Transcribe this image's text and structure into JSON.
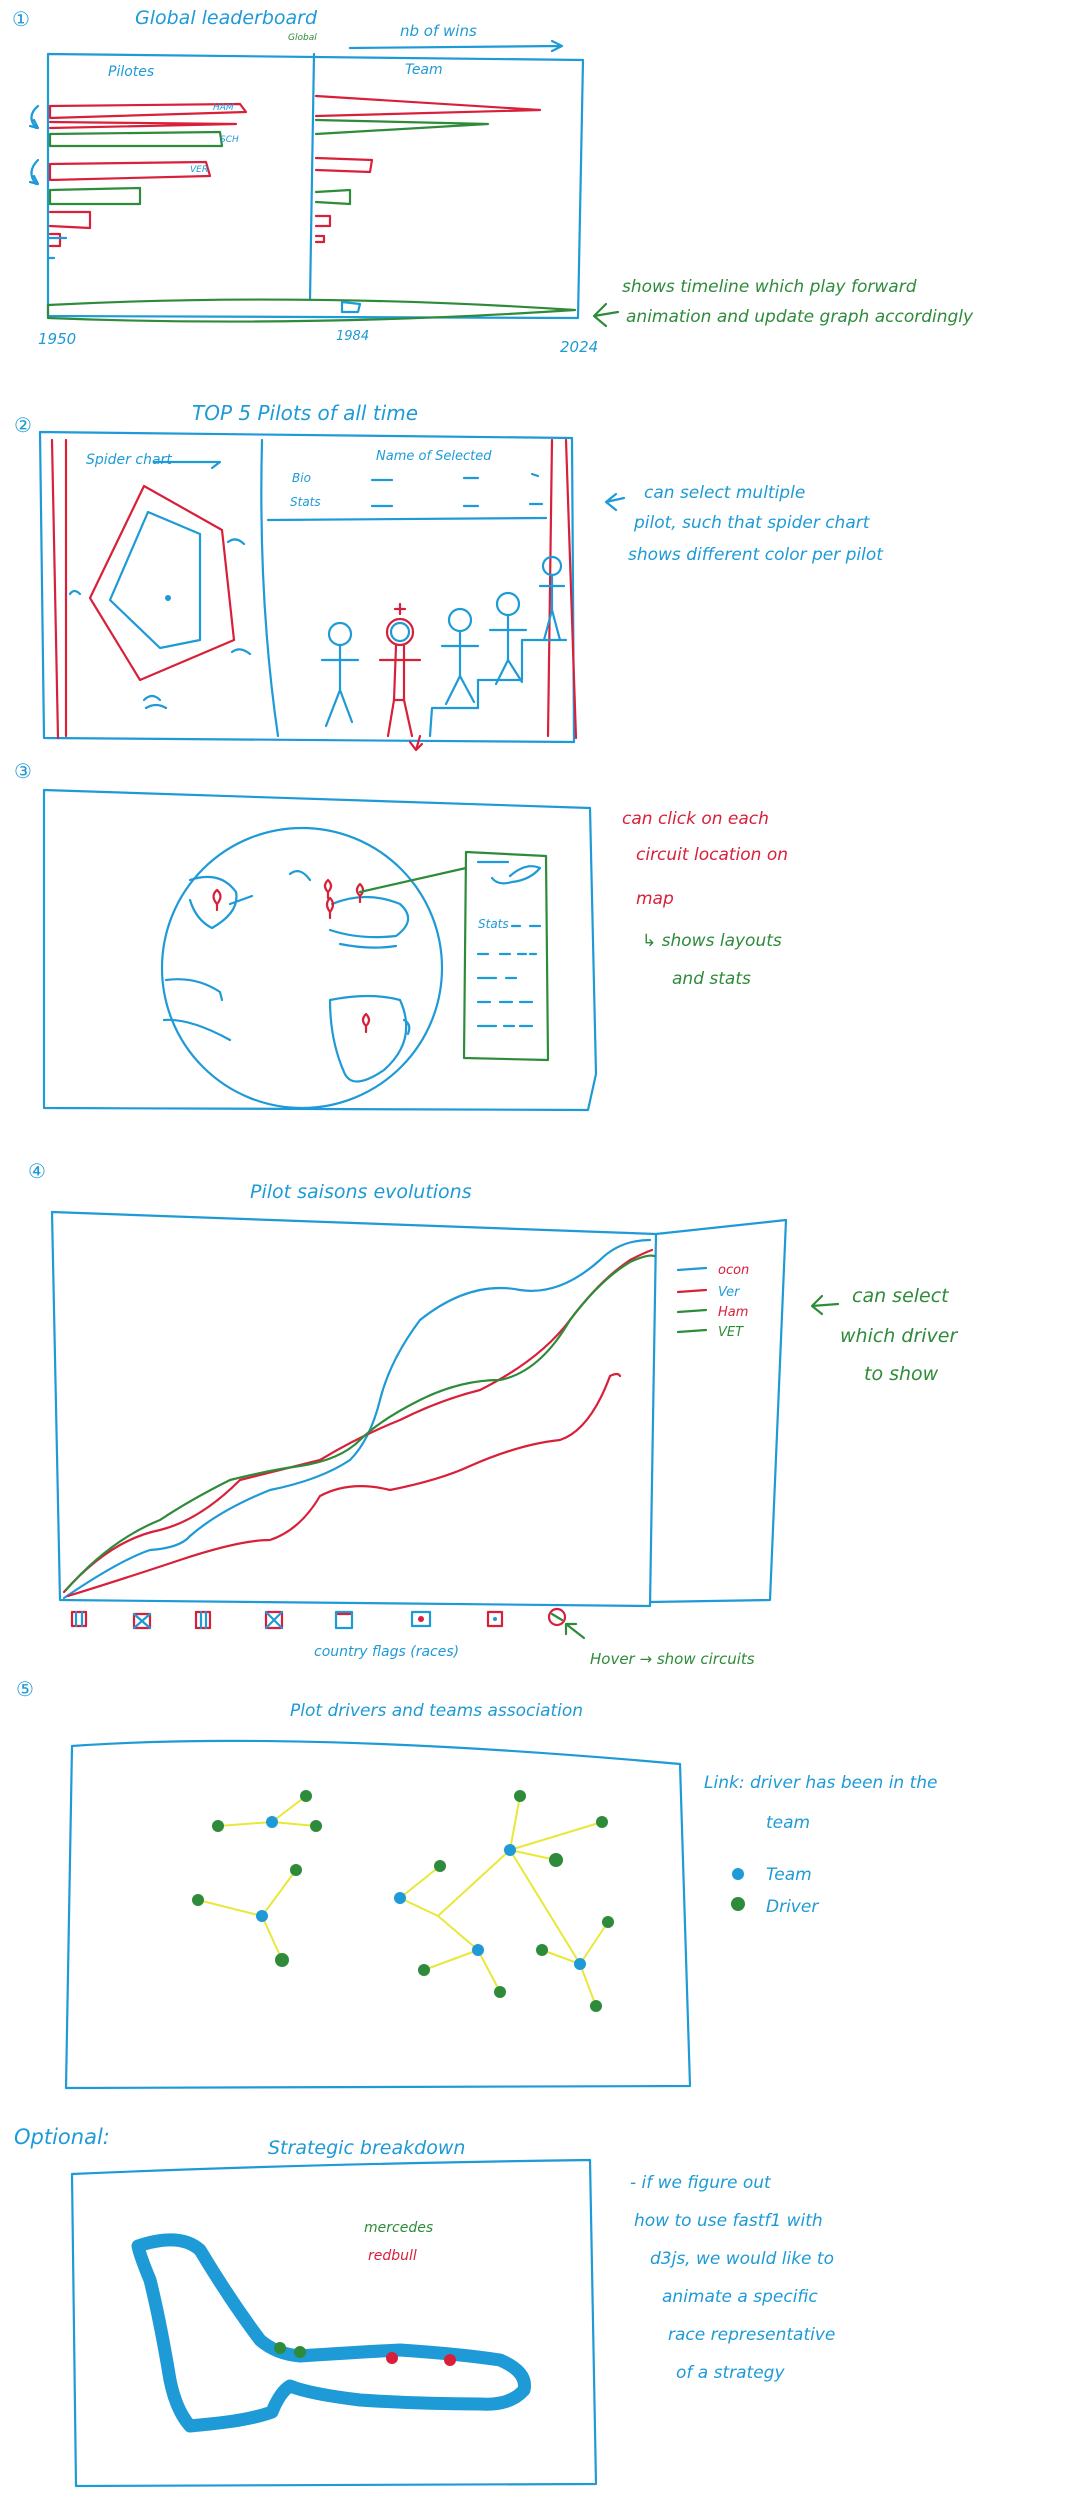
{
  "colors": {
    "blue": "#1e9ad6",
    "green": "#2e8b3a",
    "red": "#d8203a",
    "yellow": "#e8e838"
  },
  "s1": {
    "num": "①",
    "title": "Global leaderboard",
    "title_sub": "Global",
    "wins_label": "nb of wins",
    "col_pilotes": "Pilotes",
    "col_team": "Team",
    "pilot_labels": [
      "HAM",
      "SCH",
      "VER"
    ],
    "year_start": "1950",
    "year_mid": "1984",
    "year_end": "2024",
    "note_line1": "shows timeline which play forward",
    "note_line2": "animation and update graph accordingly"
  },
  "s2": {
    "num": "②",
    "title": "TOP 5 Pilots of all time",
    "spider_label": "Spider chart",
    "name_label": "Name of Selected",
    "bio_label": "Bio",
    "stats_label": "Stats",
    "note_line1": "can select multiple",
    "note_line2": "pilot, such that spider chart",
    "note_line3": "shows different color per pilot"
  },
  "s3": {
    "num": "③",
    "panel_stats": "Stats",
    "note_line1": "can click on each",
    "note_line2": "circuit location on",
    "note_line3": "map",
    "note_line4": "↳ shows layouts",
    "note_line5": "and stats"
  },
  "s4": {
    "num": "④",
    "title": "Pilot saisons evolutions",
    "legend": [
      "ocon",
      "Ver",
      "Ham",
      "VET"
    ],
    "flags_label": "country flags (races)",
    "hover_label": "Hover → show circuits",
    "note_line1": "can select",
    "note_line2": "which driver",
    "note_line3": "to show"
  },
  "s5": {
    "num": "⑤",
    "title": "Plot drivers and teams association",
    "link_line1": "Link: driver has been in the",
    "link_line2": "team",
    "legend_team": "Team",
    "legend_driver": "Driver"
  },
  "s6": {
    "optional": "Optional:",
    "title": "Strategic breakdown",
    "team1": "mercedes",
    "team2": "redbull",
    "note_line1": "- if we figure out",
    "note_line2": "how to use fastf1 with",
    "note_line3": "d3js, we would like to",
    "note_line4": "animate a specific",
    "note_line5": "race representative",
    "note_line6": "of a strategy"
  }
}
